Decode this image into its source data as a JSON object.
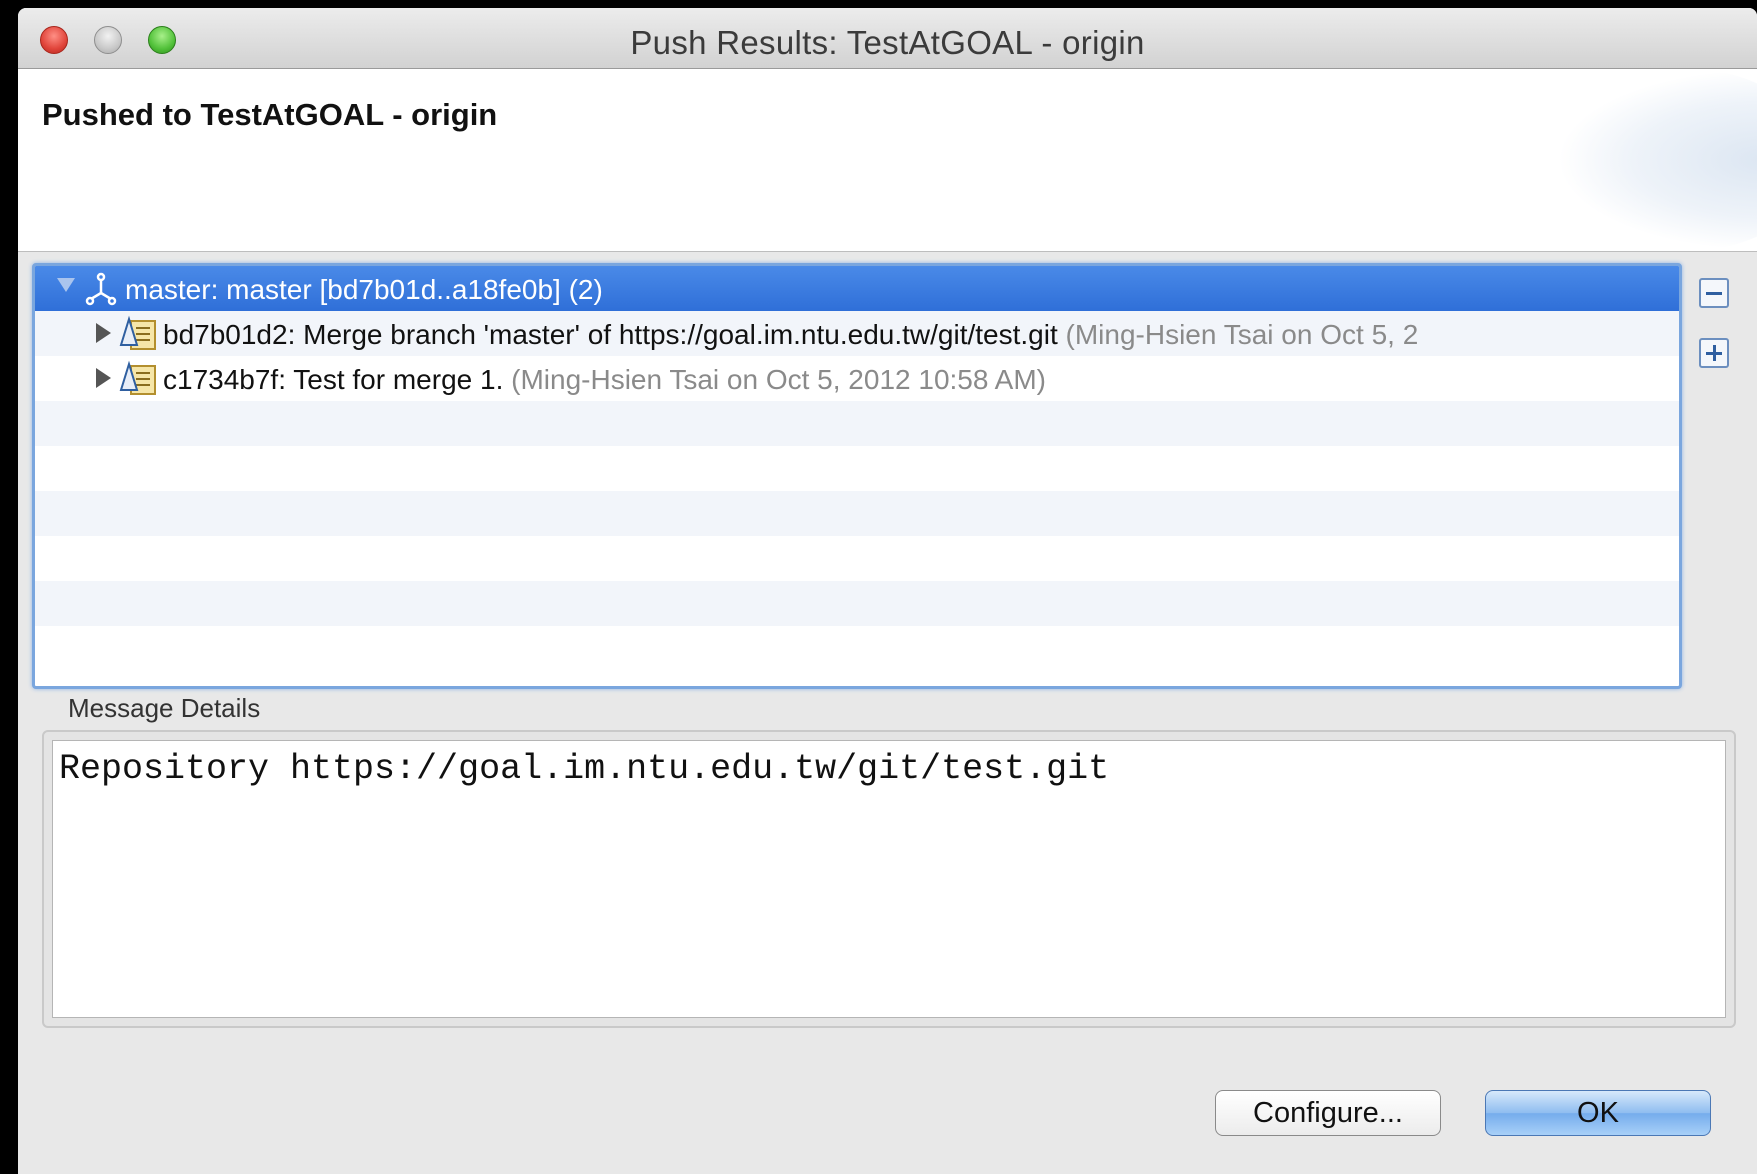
{
  "window": {
    "title": "Push Results: TestAtGOAL - origin"
  },
  "header": {
    "title": "Pushed to TestAtGOAL - origin"
  },
  "tree": {
    "branch_row": {
      "label": "master: master [bd7b01d..a18fe0b] (2)",
      "icon": "branch-icon",
      "expanded": true,
      "selected": true
    },
    "commits": [
      {
        "label": "bd7b01d2: Merge branch 'master' of https://goal.im.ntu.edu.tw/git/test.git",
        "meta": "(Ming-Hsien Tsai on Oct 5, 2",
        "icon": "commit-icon"
      },
      {
        "label": "c1734b7f: Test for merge 1.",
        "meta": "(Ming-Hsien Tsai on Oct 5, 2012 10:58 AM)",
        "icon": "commit-icon"
      }
    ]
  },
  "side_buttons": {
    "collapse_icon": "collapse-all-icon",
    "expand_icon": "expand-all-icon"
  },
  "message_details": {
    "label": "Message Details",
    "text": "Repository https://goal.im.ntu.edu.tw/git/test.git"
  },
  "buttons": {
    "configure": "Configure...",
    "ok": "OK"
  },
  "colors": {
    "selection": "#3b7be0",
    "close": "#e0443a",
    "maximize": "#52c13a",
    "meta_text": "#8a8a8a"
  }
}
